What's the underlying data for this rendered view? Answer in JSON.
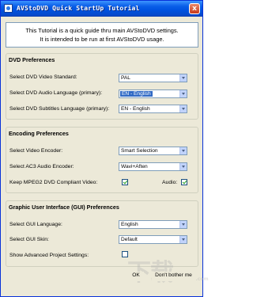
{
  "window": {
    "title": "AVStoDVD Quick StartUp Tutorial",
    "close_glyph": "x"
  },
  "intro": {
    "line1": "This Tutorial is a quick guide thru main AVStoDVD settings.",
    "line2": "It is intended to be run at first AVStoDVD usage."
  },
  "dvd_preferences": {
    "title": "DVD Preferences",
    "video_standard_label": "Select DVD Video Standard:",
    "video_standard_value": "PAL",
    "audio_language_label": "Select DVD Audio Language (primary):",
    "audio_language_value": "EN - English",
    "subtitles_language_label": "Select DVD Subtitles Language (primary):",
    "subtitles_language_value": "EN - English"
  },
  "encoding_preferences": {
    "title": "Encoding Preferences",
    "video_encoder_label": "Select Video Encoder:",
    "video_encoder_value": "Smart Selection",
    "ac3_encoder_label": "Select AC3 Audio Encoder:",
    "ac3_encoder_value": "Wavi+Aften",
    "mpeg2_compliant_label": "Keep MPEG2 DVD Compliant Video:",
    "mpeg2_compliant_checked": true,
    "audio_label": "Audio:",
    "audio_checked": true
  },
  "gui_preferences": {
    "title": "Graphic User Interface (GUI) Preferences",
    "language_label": "Select GUI Language:",
    "language_value": "English",
    "skin_label": "Select GUI Skin:",
    "skin_value": "Default",
    "advanced_label": "Show Advanced Project Settings:",
    "advanced_checked": false
  },
  "buttons": {
    "ok": "OK",
    "no_thanks": "Don't bother me"
  },
  "watermark": {
    "text": "下载",
    "site": "www.xiazaiba.com"
  },
  "colors": {
    "titlebar": "#0053e0",
    "selection": "#316ac5",
    "dialog_bg": "#ece9d8"
  }
}
